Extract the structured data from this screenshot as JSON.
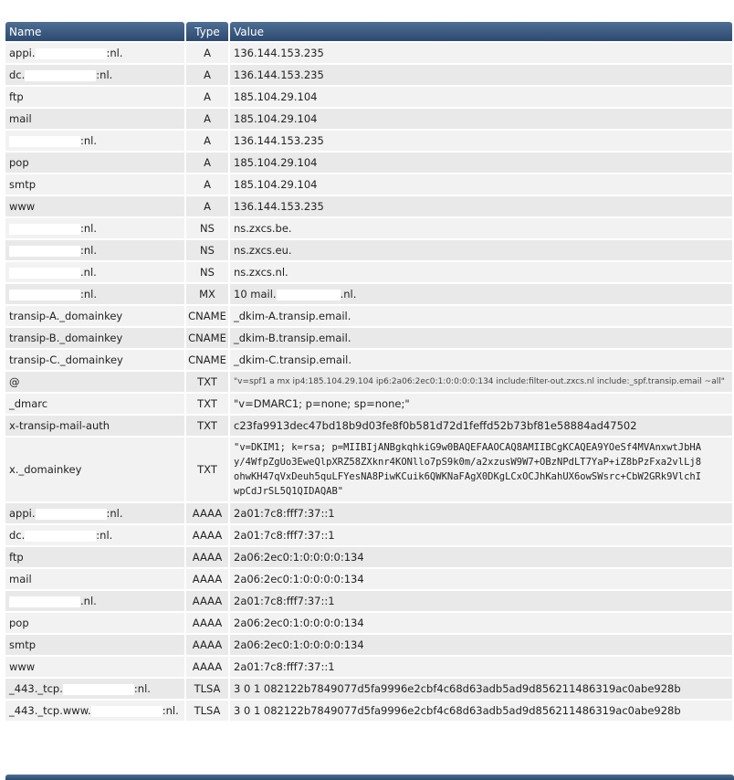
{
  "columns": {
    "name": "Name",
    "type": "Type",
    "value": "Value"
  },
  "rows": [
    {
      "name": "appi.",
      "name_suffix": ":nl.",
      "type": "A",
      "value": "136.144.153.235"
    },
    {
      "name": "dc.",
      "name_suffix": ":nl.",
      "type": "A",
      "value": "136.144.153.235"
    },
    {
      "name": "ftp",
      "name_suffix": "",
      "type": "A",
      "value": "185.104.29.104"
    },
    {
      "name": "mail",
      "name_suffix": "",
      "type": "A",
      "value": "185.104.29.104"
    },
    {
      "name": "",
      "name_suffix": ":nl.",
      "type": "A",
      "value": "136.144.153.235"
    },
    {
      "name": "pop",
      "name_suffix": "",
      "type": "A",
      "value": "185.104.29.104"
    },
    {
      "name": "smtp",
      "name_suffix": "",
      "type": "A",
      "value": "185.104.29.104"
    },
    {
      "name": "www",
      "name_suffix": "",
      "type": "A",
      "value": "136.144.153.235"
    },
    {
      "name": "",
      "name_suffix": ":nl.",
      "type": "NS",
      "value": "ns.zxcs.be."
    },
    {
      "name": "",
      "name_suffix": ":nl.",
      "type": "NS",
      "value": "ns.zxcs.eu."
    },
    {
      "name": "",
      "name_suffix": ".nl.",
      "type": "NS",
      "value": "ns.zxcs.nl."
    },
    {
      "name": "",
      "name_suffix": ":nl.",
      "type": "MX",
      "value": "10 mail.",
      "value_suffix": ".nl."
    },
    {
      "name": "transip-A._domainkey",
      "name_suffix": "",
      "type": "CNAME",
      "value": "_dkim-A.transip.email."
    },
    {
      "name": "transip-B._domainkey",
      "name_suffix": "",
      "type": "CNAME",
      "value": "_dkim-B.transip.email."
    },
    {
      "name": "transip-C._domainkey",
      "name_suffix": "",
      "type": "CNAME",
      "value": "_dkim-C.transip.email."
    },
    {
      "name": "@",
      "name_suffix": "",
      "type": "TXT",
      "value": "\"v=spf1 a mx ip4:185.104.29.104 ip6:2a06:2ec0:1:0:0:0:0:134 include:filter-out.zxcs.nl include:_spf.transip.email ~all\"",
      "style": "tiny"
    },
    {
      "name": "_dmarc",
      "name_suffix": "",
      "type": "TXT",
      "value": "\"v=DMARC1; p=none; sp=none;\""
    },
    {
      "name": "x-transip-mail-auth",
      "name_suffix": "",
      "type": "TXT",
      "value": "c23fa9913dec47bd18b9d03fe8f0b581d72d1feffd52b73bf81e58884ad47502"
    },
    {
      "name": "x._domainkey",
      "name_suffix": "",
      "type": "TXT",
      "value": "\"v=DKIM1; k=rsa; p=MIIBIjANBgkqhkiG9w0BAQEFAAOCAQ8AMIIBCgKCAQEA9YOeSf4MVAnxwtJbHA\ny/4WfpZgUo3EweQlpXRZ58ZXknr4KONllo7pS9k0m/a2xzusW9W7+OBzNPdLT7YaP+iZ8bPzFxa2vlLj8\nohwKH47qVxDeuh5quLFYesNA8PiwKCuik6QWKNaFAgX0DKgLCxOCJhKahUX6owSWsrc+CbW2GRk9VlchI\nwpCdJrSL5Q1QIDAQAB\"",
      "style": "mono"
    },
    {
      "name": "appi.",
      "name_suffix": ":nl.",
      "type": "AAAA",
      "value": "2a01:7c8:fff7:37::1"
    },
    {
      "name": "dc.",
      "name_suffix": ":nl.",
      "type": "AAAA",
      "value": "2a01:7c8:fff7:37::1"
    },
    {
      "name": "ftp",
      "name_suffix": "",
      "type": "AAAA",
      "value": "2a06:2ec0:1:0:0:0:0:134"
    },
    {
      "name": "mail",
      "name_suffix": "",
      "type": "AAAA",
      "value": "2a06:2ec0:1:0:0:0:0:134"
    },
    {
      "name": "",
      "name_suffix": ".nl.",
      "type": "AAAA",
      "value": "2a01:7c8:fff7:37::1"
    },
    {
      "name": "pop",
      "name_suffix": "",
      "type": "AAAA",
      "value": "2a06:2ec0:1:0:0:0:0:134"
    },
    {
      "name": "smtp",
      "name_suffix": "",
      "type": "AAAA",
      "value": "2a06:2ec0:1:0:0:0:0:134"
    },
    {
      "name": "www",
      "name_suffix": "",
      "type": "AAAA",
      "value": "2a01:7c8:fff7:37::1"
    },
    {
      "name": "_443._tcp.",
      "name_suffix": ":nl.",
      "type": "TLSA",
      "value": "3 0 1 082122b7849077d5fa9996e2cbf4c68d63adb5ad9d856211486319ac0abe928b"
    },
    {
      "name": "_443._tcp.www.",
      "name_suffix": ":nl.",
      "type": "TLSA",
      "value": "3 0 1 082122b7849077d5fa9996e2cbf4c68d63adb5ad9d856211486319ac0abe928b"
    }
  ]
}
